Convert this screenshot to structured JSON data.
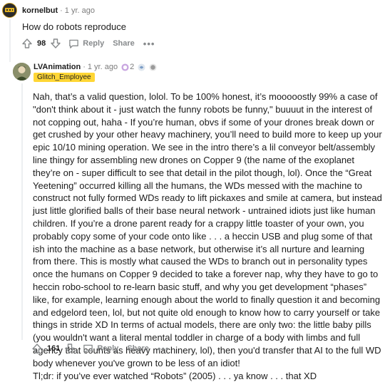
{
  "comment1": {
    "username": "kornelbut",
    "age": "1 yr. ago",
    "body": "How do robots reproduce",
    "score": "98",
    "reply_label": "Reply",
    "share_label": "Share",
    "more_label": "•••"
  },
  "comment2": {
    "username": "LVAnimation",
    "age": "1 yr. ago",
    "award_count": "2",
    "flair": "Glitch_Employee",
    "paragraphs": [
      "Nah, that’s a valid question, lolol. To be 100% honest, it’s mooooostly 99% a case of \"don't think about it - just watch the funny robots be funny,\" buuuut in the interest of not copping out, haha - If you’re human, obvs if some of your drones break down or get crushed by your other heavy machinery, you’ll need to build more to keep up your epic 10/10 mining operation. We see in the intro there’s a lil conveyor belt/assembly line thingy for assembling new drones on Copper 9 (the name of the exoplanet they’re on - super difficult to see that detail in the pilot though, lol). Once the “Great Yeetening” occurred killing all the humans, the WDs messed with the machine to construct not fully formed WDs ready to lift pickaxes and smile at camera, but instead just little glorified balls of their base neural network - untrained idiots just like human children. If you’re a drone parent ready for a crappy little toaster of your own, you probably copy some of your code onto like . . . a heccin USB and plug some of that ish into the machine as a base network, but otherwise it’s all nurture and learning from there. This is mostly what caused the WDs to branch out in personality types once the humans on Copper 9 decided to take a forever nap, why they have to go to heccin robo-school to re-learn basic stuff, and why you get development “phases” like, for example, learning enough about the world to finally question it and becoming and edgelord teen, lol, but not quite old enough to know how to carry yourself or take things in stride XD In terms of actual models, there are only two: the little baby pills (you wouldn't want a literal mental toddler in charge of a body with limbs and full agency that counts as heavy machinery, lol), then you'd transfer that AI to the full WD body whenever you've grown to be less of an idiot!",
      "Tl;dr: if you’ve ever watched “Robots” (2005) . . . ya know . . . that XD"
    ],
    "score": "161",
    "reply_label": "Reply",
    "share_label": "Share",
    "more_label": "•••"
  },
  "colors": {
    "flair_bg": "#ffd635",
    "meta_text": "#7c7c7c",
    "action_text": "#878a8c"
  }
}
